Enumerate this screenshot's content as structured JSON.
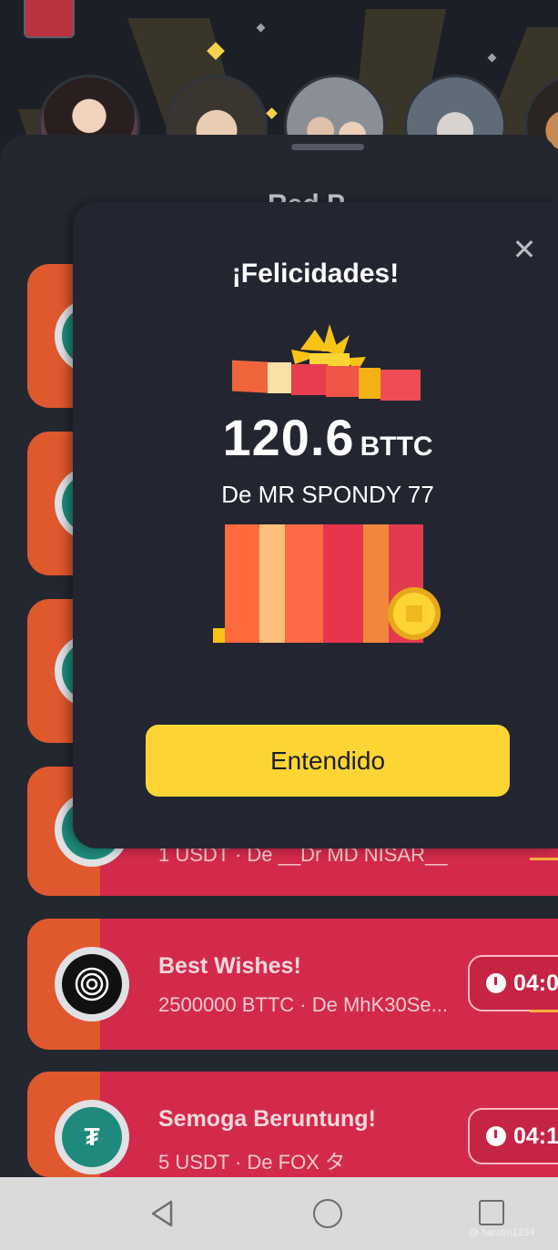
{
  "sheet": {
    "title": "Red P"
  },
  "cards": [
    {
      "title": "",
      "subtitle": "",
      "timer": ""
    },
    {
      "title": "",
      "subtitle": "",
      "timer": ""
    },
    {
      "title": "",
      "subtitle": "",
      "timer": ""
    },
    {
      "title": "",
      "subtitle": "1 USDT · De __Dr MD NISAR__",
      "timer": ""
    },
    {
      "title": "Best Wishes!",
      "subtitle": "2500000 BTTC · De MhK30Se...",
      "timer": "04:0"
    },
    {
      "title": "Semoga Beruntung!",
      "subtitle": "5 USDT · De FOX タ",
      "timer": "04:1"
    }
  ],
  "dialog": {
    "title": "¡Felicidades!",
    "amount": "120.6",
    "unit": "BTTC",
    "from": "De MR SPONDY 77",
    "button_label": "Entendido"
  },
  "watermark": "@ harolm1234",
  "colors": {
    "accent": "#fcd535",
    "card_red": "#d32a4b",
    "card_orange": "#e0582e",
    "dialog_bg": "#232630"
  }
}
